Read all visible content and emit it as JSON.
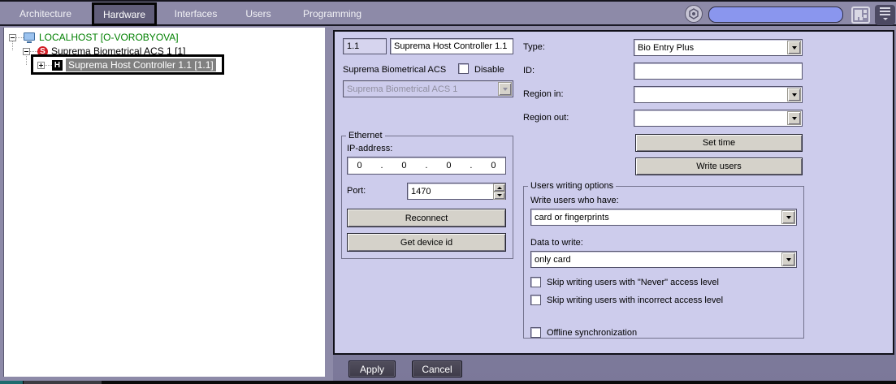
{
  "menubar": {
    "items": [
      {
        "label": "Architecture"
      },
      {
        "label": "Hardware"
      },
      {
        "label": "Interfaces"
      },
      {
        "label": "Users"
      },
      {
        "label": "Programming"
      }
    ],
    "active_item": "Hardware",
    "search": {
      "value": "",
      "placeholder": ""
    },
    "icons": [
      "settings-icon",
      "layout-grid-icon",
      "hamburger-menu-icon"
    ]
  },
  "tree": {
    "nodes": [
      {
        "label": "LOCALHOST [O-VOROBYOVA]",
        "icon": "computer-icon",
        "expander": "minus",
        "selected": false
      },
      {
        "label": "Suprema Biometrical ACS 1 [1]",
        "icon": "suprema-s-icon",
        "expander": "minus",
        "selected": false
      },
      {
        "label": "Suprema Host Controller 1.1 [1.1]",
        "icon": "host-controller-h-icon",
        "expander": "plus",
        "selected": true
      }
    ],
    "icon_letters": {
      "suprema": "S",
      "host": "H"
    }
  },
  "panel": {
    "header": {
      "id_value": "1.1",
      "name_value": "Suprema Host Controller 1.1",
      "parent_label": "Suprema Biometrical ACS",
      "disable_label": "Disable",
      "disable_checked": false,
      "parent_value": "Suprema Biometrical ACS 1"
    },
    "ethernet": {
      "title": "Ethernet",
      "ip_label": "IP-address:",
      "ip_octets": [
        "0",
        "0",
        "0",
        "0"
      ],
      "ip_separator": ".",
      "port_label": "Port:",
      "port_value": "1470",
      "reconnect_label": "Reconnect",
      "get_device_id_label": "Get device id"
    },
    "device": {
      "type_label": "Type:",
      "type_value": "Bio Entry Plus",
      "id_label": "ID:",
      "id_value": "",
      "region_in_label": "Region in:",
      "region_in_value": "",
      "region_out_label": "Region out:",
      "region_out_value": "",
      "set_time_label": "Set time",
      "write_users_label": "Write users"
    },
    "users_writing": {
      "title": "Users writing options",
      "who_label": "Write users who have:",
      "who_value": "card or fingerprints",
      "data_label": "Data to write:",
      "data_value": "only card",
      "checkboxes": [
        {
          "label": "Skip writing users with \"Never\" access level",
          "checked": false
        },
        {
          "label": "Skip writing users with incorrect access level",
          "checked": false
        },
        {
          "label": "Offline synchronization",
          "checked": false
        }
      ]
    },
    "footer": {
      "apply_label": "Apply",
      "cancel_label": "Cancel"
    }
  },
  "colors": {
    "panel_bg": "#cdccec",
    "topbar_bg": "#8d8aa8",
    "tree_root_text": "#008000",
    "selection_bg": "#808080",
    "suprema_icon_red": "#d21f26",
    "search_field_blue": "#8a96ee",
    "dark_button_bg": "#45424f"
  }
}
